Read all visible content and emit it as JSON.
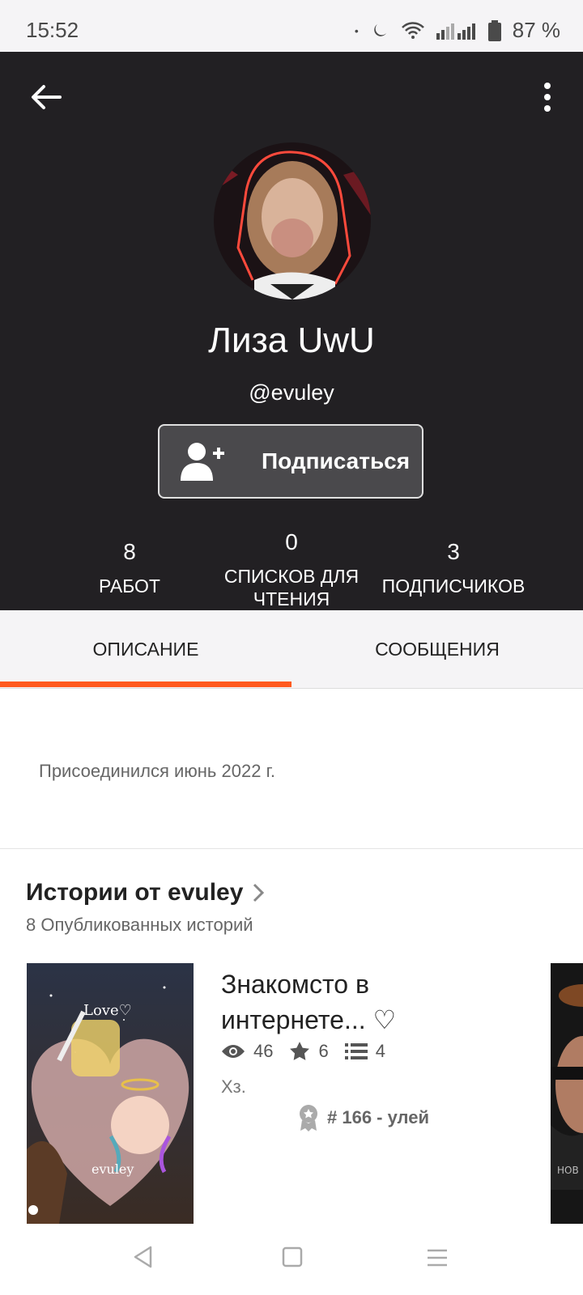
{
  "status_bar": {
    "time": "15:52",
    "battery": "87 %"
  },
  "profile": {
    "display_name": "Лиза UwU",
    "username": "@evuley",
    "follow_label": "Подписаться",
    "stats": [
      {
        "value": "8",
        "label": "РАБОТ"
      },
      {
        "value": "0",
        "label": "СПИСКОВ ДЛЯ ЧТЕНИЯ"
      },
      {
        "value": "3",
        "label": "ПОДПИСЧИКОВ"
      }
    ]
  },
  "tabs": [
    {
      "label": "ОПИСАНИЕ",
      "active": true
    },
    {
      "label": "СООБЩЕНИЯ",
      "active": false
    }
  ],
  "about": {
    "joined": "Присоединился июнь 2022 г."
  },
  "stories_section": {
    "title": "Истории от evuley",
    "subtitle": "8 Опубликованных историй",
    "story": {
      "title": "Знакомсто в интернете... ♡",
      "views": "46",
      "votes": "6",
      "parts": "4",
      "description": "Хз.",
      "rank": "# 166 - улей",
      "cover_text_love": "Love♡",
      "cover_text_author": "evuley"
    },
    "peek_text": "НОВ"
  },
  "colors": {
    "header_bg": "#222023",
    "accent": "#ff5a1f"
  }
}
